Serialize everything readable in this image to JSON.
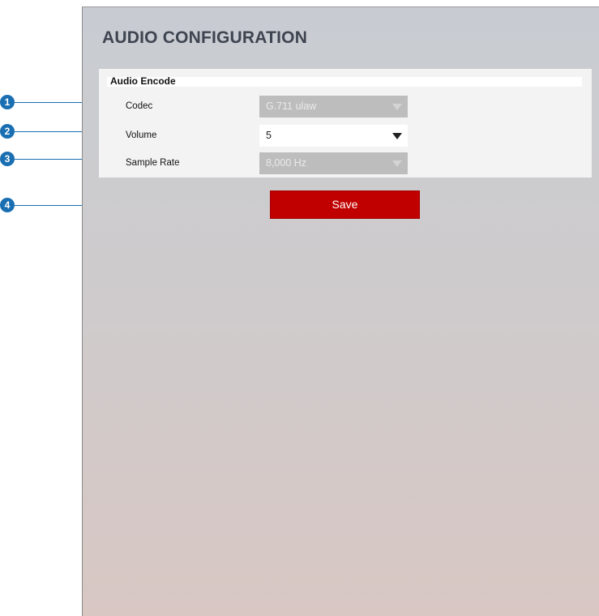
{
  "page": {
    "title": "AUDIO CONFIGURATION"
  },
  "section": {
    "title": "Audio Encode"
  },
  "fields": [
    {
      "label": "Codec",
      "value": "G.711 ulaw",
      "enabled": false
    },
    {
      "label": "Volume",
      "value": "5",
      "enabled": true
    },
    {
      "label": "Sample Rate",
      "value": "8,000 Hz",
      "enabled": false
    }
  ],
  "save_button": {
    "label": "Save",
    "color": "#c00000"
  },
  "callouts": [
    "1",
    "2",
    "3",
    "4"
  ],
  "colors": {
    "callout": "#1a6fb2",
    "title": "#3e4450"
  }
}
